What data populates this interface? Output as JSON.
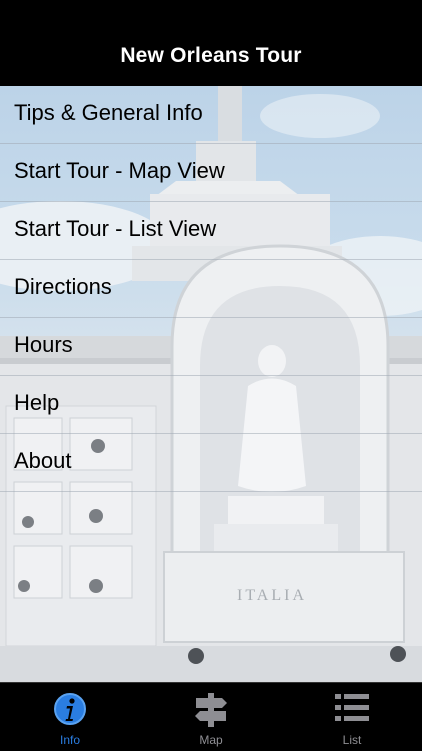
{
  "navbar": {
    "title": "New Orleans Tour"
  },
  "menu": {
    "items": [
      {
        "label": "Tips & General Info"
      },
      {
        "label": "Start Tour - Map View"
      },
      {
        "label": "Start Tour - List View"
      },
      {
        "label": "Directions"
      },
      {
        "label": "Hours"
      },
      {
        "label": "Help"
      },
      {
        "label": "About"
      }
    ]
  },
  "background": {
    "inscription": "ITALIA"
  },
  "tabbar": {
    "tabs": [
      {
        "label": "Info",
        "icon": "info-icon",
        "selected": true
      },
      {
        "label": "Map",
        "icon": "signpost-icon",
        "selected": false
      },
      {
        "label": "List",
        "icon": "list-icon",
        "selected": false
      }
    ]
  },
  "colors": {
    "accent": "#2a7de1",
    "inactive_tab": "#8e8e93",
    "bar": "#000000"
  }
}
